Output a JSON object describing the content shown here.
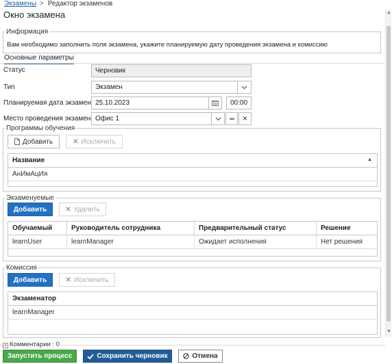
{
  "breadcrumb": {
    "link": "Экзамены",
    "separator": ">",
    "current": "Редактор экзаменов"
  },
  "window_title": "Окно экзамена",
  "info": {
    "legend": "Информация",
    "text": "Вам необходимо заполнить поля экзамена, укажите планируемую дату проведения экзамена и комиссию"
  },
  "tab": {
    "label": "Основные параметры"
  },
  "form": {
    "status": {
      "label": "Статус",
      "value": "Черновик"
    },
    "type": {
      "label": "Тип",
      "value": "Экзамен"
    },
    "planned_date": {
      "label": "Планируемая дата экзамена",
      "date": "25.10.2023",
      "time": "00:00"
    },
    "location": {
      "label": "Место проведения экзамена",
      "value": "Офис 1"
    }
  },
  "programs": {
    "legend": "Программы обучения",
    "add_label": "Добавить",
    "exclude_label": "Исключить",
    "columns": [
      "Название"
    ],
    "rows": [
      [
        "АнИмАцИя"
      ]
    ]
  },
  "examinees": {
    "legend": "Экзаменуемые",
    "add_label": "Добавить",
    "delete_label": "Удалить",
    "columns": [
      "Обучаемый",
      "Руководитель сотрудника",
      "Предварительный статус",
      "Решение"
    ],
    "rows": [
      [
        "learnUser",
        "learnManager",
        "Ожидает исполнения",
        "Нет решения"
      ]
    ]
  },
  "commission": {
    "legend": "Комиссия",
    "add_label": "Добавить",
    "exclude_label": "Исключить",
    "columns": [
      "Экзаменатор"
    ],
    "rows": [
      [
        "learnManager"
      ]
    ]
  },
  "comments": {
    "label": "Комментарии : 0"
  },
  "footer": {
    "start_label": "Запустить процесс",
    "save_draft_label": "Сохранить черновик",
    "cancel_label": "Отмена"
  },
  "colors": {
    "blue": "#2371c2",
    "green": "#4aa84a",
    "navy": "#235d96"
  },
  "icons": [
    "document-icon",
    "x-icon",
    "calendar-icon",
    "chevron-down-icon",
    "ellipsis-icon",
    "sort-up-icon",
    "check-icon",
    "cancel-circle-icon",
    "plus-box-icon"
  ]
}
